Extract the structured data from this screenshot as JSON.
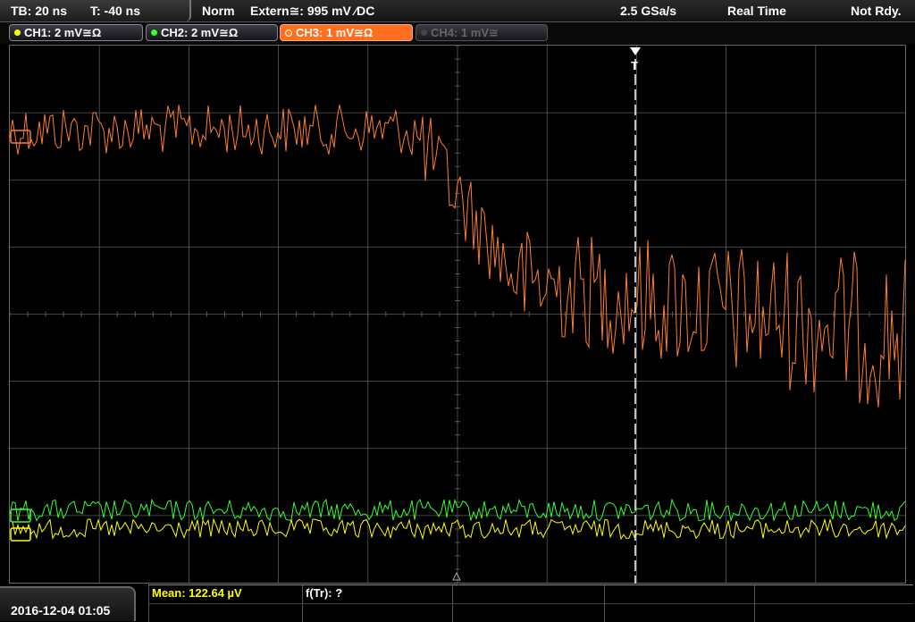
{
  "status_bar": {
    "timebase": "TB: 20 ns",
    "trigger_time": "T: -40 ns",
    "trigger_mode": "Norm",
    "trigger_source": "Extern≅: 995 mV ⁄DC",
    "sample_rate": "2.5 GSa/s",
    "acquisition_mode": "Real Time",
    "state": "Not Rdy."
  },
  "channels": [
    {
      "label": "CH1: 2 mV≅Ω",
      "color": "#ffff00",
      "active": false,
      "enabled": true
    },
    {
      "label": "CH2: 2 mV≅Ω",
      "color": "#33ff33",
      "active": false,
      "enabled": true
    },
    {
      "label": "CH3: 1 mV≅Ω",
      "color": "#ff7f2a",
      "active": true,
      "enabled": true
    },
    {
      "label": "CH4: 1 mV≅",
      "color": "#666666",
      "active": false,
      "enabled": false
    }
  ],
  "trigger_marker": {
    "label": "T"
  },
  "date_time": "2016-12-04 01:05",
  "measurements": {
    "mean": "Mean: 122.64 µV",
    "rise_time": "f(Tr): ?"
  },
  "colors": {
    "ch1": "#ffff00",
    "ch2": "#33ff33",
    "ch3": "#ff7f2a",
    "grid": "#5a5a5a"
  }
}
